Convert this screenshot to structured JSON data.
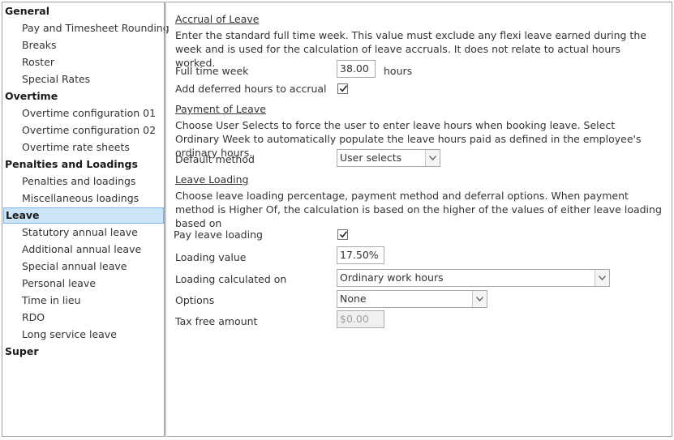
{
  "sidebar": {
    "groups": [
      {
        "label": "General",
        "items": [
          "Pay and Timesheet Rounding",
          "Breaks",
          "Roster",
          "Special Rates"
        ]
      },
      {
        "label": "Overtime",
        "items": [
          "Overtime configuration 01",
          "Overtime configuration 02",
          "Overtime rate sheets"
        ]
      },
      {
        "label": "Penalties and Loadings",
        "items": [
          "Penalties and loadings",
          "Miscellaneous loadings"
        ]
      },
      {
        "label": "Leave",
        "selected": true,
        "items": [
          "Statutory annual leave",
          "Additional annual leave",
          "Special annual leave",
          "Personal leave",
          "Time in lieu",
          "RDO",
          "Long service leave"
        ]
      },
      {
        "label": "Super",
        "items": []
      }
    ]
  },
  "accrual": {
    "title": "Accrual of Leave",
    "description": "Enter the standard full time week. This value must exclude any flexi leave earned during the week and is used for the calculation of leave accruals. It does not relate to actual hours worked.",
    "full_time_week_label": "Full time week",
    "full_time_week_value": "38.00",
    "hours_unit": "hours",
    "add_deferred_label": "Add deferred hours to accrual",
    "add_deferred_checked": true
  },
  "payment": {
    "title": "Payment of Leave",
    "description": "Choose User Selects to force the user to enter leave hours when booking leave. Select Ordinary Week to automatically populate the leave hours paid as defined in the employee's ordinary hours.",
    "default_method_label": "Default method",
    "default_method_value": "User selects"
  },
  "loading": {
    "title": "Leave Loading",
    "description": "Choose leave loading percentage, payment method and deferral options. When payment method is Higher Of, the calculation is based on the higher of the values of either leave loading based on",
    "pay_leave_loading_label": "Pay leave loading",
    "pay_leave_loading_checked": true,
    "loading_value_label": "Loading value",
    "loading_value": "17.50%",
    "calculated_on_label": "Loading calculated on",
    "calculated_on_value": "Ordinary work hours",
    "options_label": "Options",
    "options_value": "None",
    "tax_free_label": "Tax free amount",
    "tax_free_value": "$0.00"
  },
  "colors": {
    "selection_bg": "#cce4f7",
    "selection_border": "#7eb4ea",
    "border": "#a0a0a0"
  }
}
